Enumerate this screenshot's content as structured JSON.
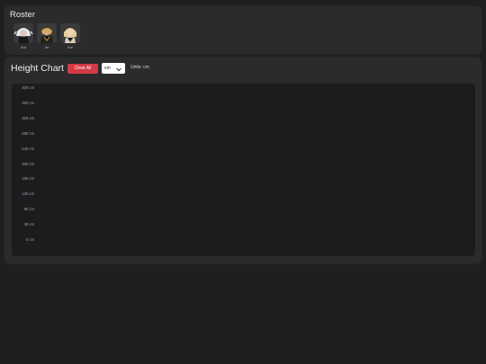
{
  "roster": {
    "title": "Roster",
    "characters": [
      {
        "name": "Ara",
        "icon": "white-hair-character-icon"
      },
      {
        "name": "Jin",
        "icon": "dark-armor-character-icon"
      },
      {
        "name": "Kai",
        "icon": "blonde-character-icon"
      }
    ]
  },
  "chart": {
    "title": "Height Chart",
    "clear_label": "Clear All",
    "unit_value": "cm",
    "units_text": "Units: cm",
    "ticks": [
      "400 cm",
      "360 cm",
      "320 cm",
      "280 cm",
      "240 cm",
      "200 cm",
      "160 cm",
      "120 cm",
      "80 cm",
      "40 cm",
      "0 cm"
    ]
  },
  "colors": {
    "accent": "#d43a46",
    "background": "#1f1f21",
    "panel": "#2b2b2d"
  }
}
